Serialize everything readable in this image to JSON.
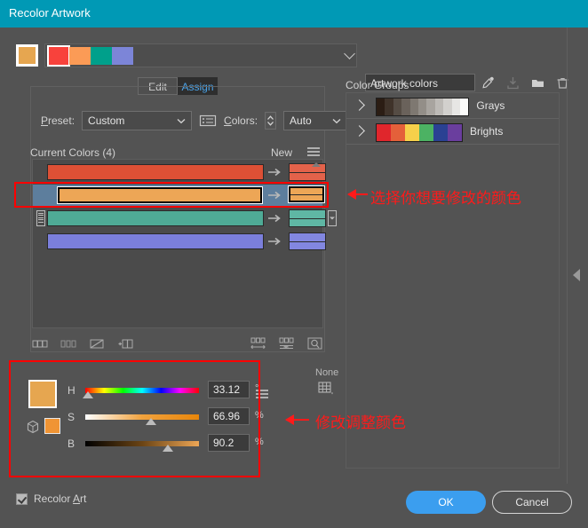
{
  "window": {
    "title": "Recolor Artwork",
    "titlebar_color": "#0099b5",
    "background": "#535353"
  },
  "topbar": {
    "active_swatch_color": "#e6a650",
    "artwork_swatches": [
      {
        "color": "#f8423c",
        "selected": true
      },
      {
        "color": "#fb9b56",
        "selected": false
      },
      {
        "color": "#00a08b",
        "selected": false
      },
      {
        "color": "#7c85d8",
        "selected": false
      }
    ],
    "dropdown_icon": "chevron-down-icon",
    "color_group_name": "Artwork colors",
    "icons": [
      {
        "name": "eyedropper-icon",
        "enabled": true
      },
      {
        "name": "save-to-swatches-icon",
        "enabled": false
      },
      {
        "name": "new-color-group-folder-icon",
        "enabled": true
      },
      {
        "name": "delete-trash-icon",
        "enabled": true
      }
    ]
  },
  "tabs": [
    {
      "label": "Edit",
      "active": false
    },
    {
      "label": "Assign",
      "active": true
    }
  ],
  "controls": {
    "preset_label": "Preset:",
    "preset_value": "Custom",
    "preset_options_icon": "list-options-icon",
    "colors_label": "Colors:",
    "colors_value": "Auto",
    "stepper_icon": "up-down-stepper-icon"
  },
  "current_colors": {
    "header_label": "Current Colors (4)",
    "new_label": "New",
    "menu_icon": "hamburger-menu-icon",
    "rows": [
      {
        "current": "#dd5035",
        "new": "#e3624a",
        "selected": false,
        "has_grip": false,
        "has_caret": false
      },
      {
        "current": "#eda656",
        "new": "#eda656",
        "selected": true,
        "has_grip": false,
        "has_caret": false
      },
      {
        "current": "#4fab96",
        "new": "#5fb7a4",
        "selected": false,
        "has_grip": true,
        "has_caret": true
      },
      {
        "current": "#7b7fdc",
        "new": "#8287e0",
        "selected": false,
        "has_grip": false,
        "has_caret": false
      }
    ],
    "arrow_icon": "arrow-right-icon",
    "scroll_icon": "scroll-up-icon"
  },
  "list_toolbar": {
    "left_icons": [
      {
        "name": "merge-colors-icon"
      },
      {
        "name": "separate-colors-icon"
      },
      {
        "name": "exclude-colors-icon"
      },
      {
        "name": "add-color-row-icon"
      }
    ],
    "right_icons": [
      {
        "name": "randomize-saturation-brightness-icon"
      },
      {
        "name": "randomize-color-order-icon"
      },
      {
        "name": "color-reduction-options-icon"
      }
    ]
  },
  "group_status": {
    "none_label": "None",
    "grid_icon": "color-grid-icon"
  },
  "hsb": {
    "big_swatch_color": "#e6a650",
    "small_swatch_color": "#f09434",
    "cube_icon": "color-mode-cube-icon",
    "menu_icon": "hamburger-menu-icon",
    "sliders": [
      {
        "label": "H",
        "value": "33.12",
        "unit": "°",
        "thumb_pct": 9
      },
      {
        "label": "S",
        "value": "66.96",
        "unit": "%",
        "thumb_pct": 67
      },
      {
        "label": "B",
        "value": "90.2",
        "unit": "%",
        "thumb_pct": 90
      }
    ]
  },
  "color_groups": {
    "title": "Color Groups",
    "expand_icon": "chevron-right-icon",
    "groups": [
      {
        "name": "Grays",
        "colors": [
          "#2b1d14",
          "#3f332a",
          "#554c44",
          "#6a625b",
          "#7e7871",
          "#938e88",
          "#a8a49f",
          "#bdbab6",
          "#d2d0cd",
          "#e7e6e4",
          "#fbfbfa"
        ]
      },
      {
        "name": "Brights",
        "colors": [
          "#e0262c",
          "#e4603a",
          "#f6d04a",
          "#4cb263",
          "#2a4193",
          "#6a3e9e"
        ]
      }
    ]
  },
  "panel_collapse": {
    "icon": "collapse-panel-arrow-icon"
  },
  "annotations": [
    {
      "text": "选择你想要修改的颜色",
      "color": "#ff1a1a"
    },
    {
      "text": "修改调整颜色",
      "color": "#ff1a1a"
    }
  ],
  "footer": {
    "recolor_art_label": "Recolor Art",
    "recolor_art_checked": true,
    "ok_label": "OK",
    "cancel_label": "Cancel",
    "ok_color": "#3b9eef"
  }
}
